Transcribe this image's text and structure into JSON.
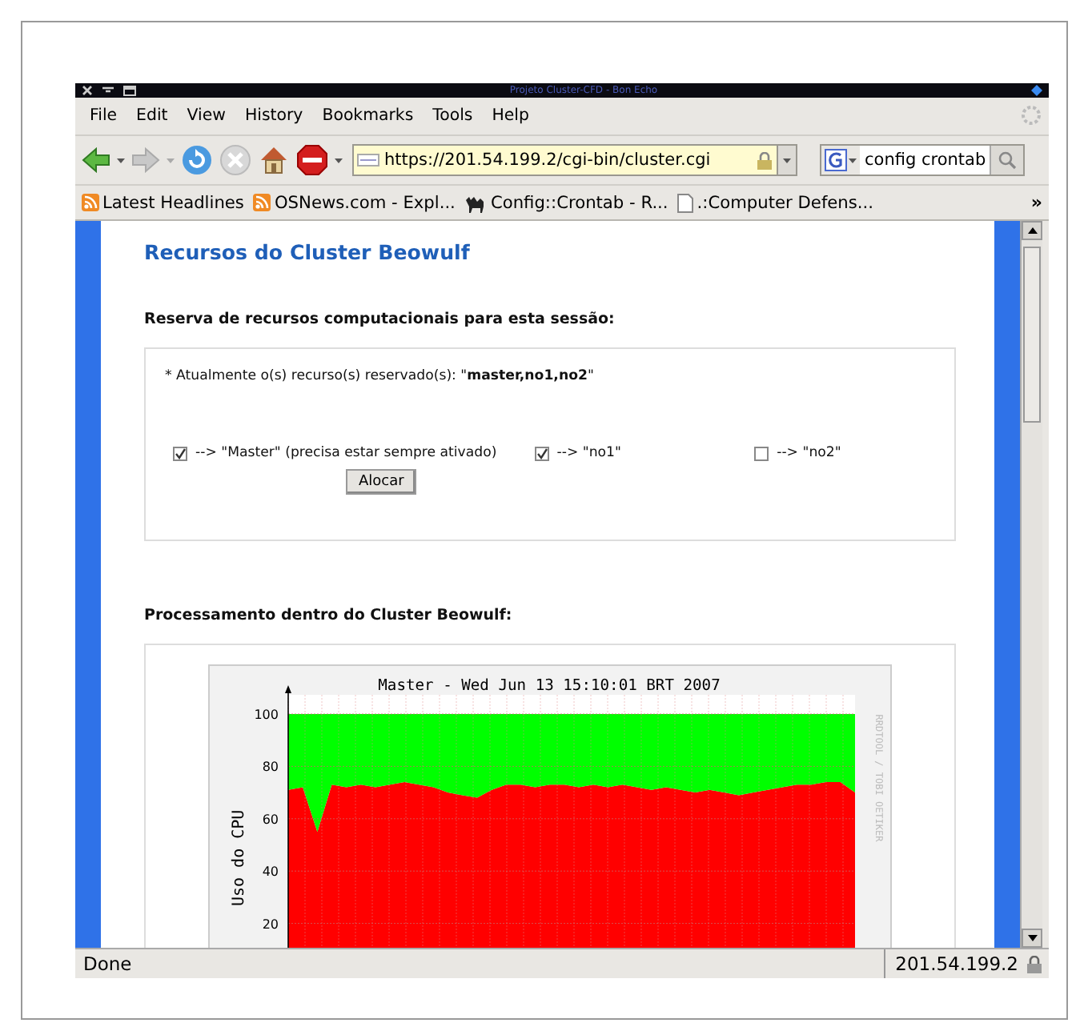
{
  "window": {
    "title": "Projeto Cluster-CFD - Bon Echo"
  },
  "menu": [
    "File",
    "Edit",
    "View",
    "History",
    "Bookmarks",
    "Tools",
    "Help"
  ],
  "toolbar": {
    "address": "https://201.54.199.2/cgi-bin/cluster.cgi",
    "search": "config crontab"
  },
  "bookmarks": [
    {
      "label": "Latest Headlines",
      "kind": "feed"
    },
    {
      "label": "OSNews.com - Expl...",
      "kind": "feed"
    },
    {
      "label": "Config::Crontab - R...",
      "kind": "camel"
    },
    {
      "label": ".:Computer Defens...",
      "kind": "page"
    }
  ],
  "bookmarks_overflow": "»",
  "page": {
    "heading": "Recursos do Cluster Beowulf",
    "reserve_title": "Reserva de recursos computacionais para esta sessão:",
    "reserved_text": "* Atualmente o(s) recurso(s) reservado(s): \"**master,no1,no2**\"",
    "nodes": [
      {
        "label": "--> \"Master\" (precisa estar sempre ativado)",
        "checked": true
      },
      {
        "label": "--> \"no1\"",
        "checked": true
      },
      {
        "label": "--> \"no2\"",
        "checked": false
      }
    ],
    "button": "Alocar",
    "processing_title": "Processamento dentro do Cluster Beowulf:",
    "chart": {
      "side_text": "RRDTOOL / TOBI OETIKER",
      "chart_data": {
        "type": "area",
        "title": "Master - Wed Jun 13 15:10:01 BRT 2007",
        "ylabel": "Uso do CPU",
        "stacked": true,
        "grid": true,
        "ylim": [
          0,
          100
        ],
        "yticks": [
          20,
          40,
          60,
          80,
          100
        ],
        "series": [
          {
            "color": "#ff0000",
            "values": [
              71,
              72,
              55,
              73,
              72,
              73,
              72,
              73,
              74,
              73,
              72,
              70,
              69,
              68,
              71,
              73,
              73,
              72,
              73,
              73,
              72,
              73,
              72,
              73,
              72,
              71,
              72,
              71,
              70,
              71,
              70,
              69,
              70,
              71,
              72,
              73,
              73,
              74,
              74,
              70
            ]
          },
          {
            "color": "#00ff00",
            "values": [
              29,
              28,
              45,
              27,
              28,
              27,
              28,
              27,
              26,
              27,
              28,
              30,
              31,
              32,
              29,
              27,
              27,
              28,
              27,
              27,
              28,
              27,
              28,
              27,
              28,
              29,
              28,
              29,
              30,
              29,
              30,
              31,
              30,
              29,
              28,
              27,
              27,
              26,
              26,
              30
            ]
          }
        ]
      }
    }
  },
  "status": {
    "text": "Done",
    "host": "201.54.199.2"
  }
}
